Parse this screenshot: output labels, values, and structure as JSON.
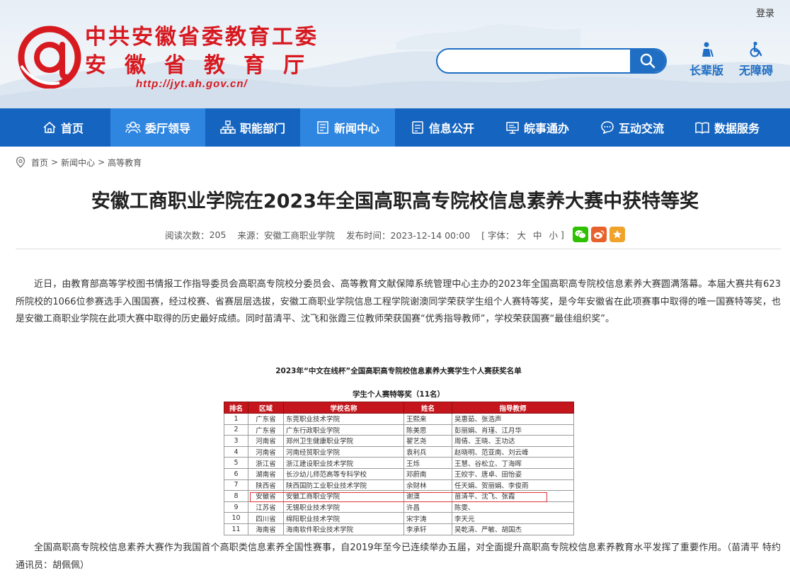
{
  "header": {
    "org_name": "中共安徽省委教育工委",
    "dept_name": "安徽省教育厅",
    "url": "http://jyt.ah.gov.cn/",
    "login": "登录",
    "search": {
      "placeholder": ""
    },
    "tools": [
      {
        "label": "长辈版",
        "icon": "elder-icon"
      },
      {
        "label": "无障碍",
        "icon": "accessibility-icon"
      }
    ]
  },
  "nav": {
    "items": [
      {
        "label": "首页",
        "icon": "home-icon"
      },
      {
        "label": "委厅领导",
        "icon": "leaders-icon"
      },
      {
        "label": "职能部门",
        "icon": "org-chart-icon"
      },
      {
        "label": "新闻中心",
        "icon": "news-icon"
      },
      {
        "label": "信息公开",
        "icon": "info-icon"
      },
      {
        "label": "皖事通办",
        "icon": "service-icon"
      },
      {
        "label": "互动交流",
        "icon": "chat-icon"
      },
      {
        "label": "数据服务",
        "icon": "data-icon"
      }
    ],
    "active_index": 3
  },
  "breadcrumb": {
    "items": [
      "首页",
      "新闻中心",
      "高等教育"
    ],
    "separator": ">"
  },
  "article": {
    "title": "安徽工商职业学院在2023年全国高职高专院校信息素养大赛中获特等奖",
    "meta": {
      "views_label": "阅读次数：",
      "views": "205",
      "source": "来源：安徽工商职业学院",
      "publish": "发布时间：2023-12-14 00:00",
      "font_open": "[ 字体：",
      "font_large": "大",
      "font_medium": "中",
      "font_small": "小",
      "font_close": "]"
    },
    "share": [
      {
        "icon": "wechat-icon",
        "color": "#2dc100"
      },
      {
        "icon": "weibo-icon",
        "color": "#e6612b"
      },
      {
        "icon": "favorite-icon",
        "color": "#f0a32a"
      }
    ],
    "paragraph1": "近日，由教育部高等学校图书情报工作指导委员会高职高专院校分委员会、高等教育文献保障系统管理中心主办的2023年全国高职高专院校信息素养大赛圆满落幕。本届大赛共有623所院校的1066位参赛选手入围国赛，经过校赛、省赛层层选拔，安徽工商职业学院信息工程学院谢澳同学荣获学生组个人赛特等奖，是今年安徽省在此项赛事中取得的唯一国赛特等奖，也是安徽工商职业学院在此项大赛中取得的历史最好成绩。同时苗清平、沈飞和张霞三位教师荣获国赛“优秀指导教师”，学校荣获国赛“最佳组织奖”。",
    "paragraph2": "全国高职高专院校信息素养大赛作为我国首个高职类信息素养全国性赛事，自2019年至今已连续举办五届，对全面提升高职高专院校信息素养教育水平发挥了重要作用。（苗清平 特约通讯员：胡佩佩）"
  },
  "awards_table": {
    "caption": "2023年“中文在线杯”全国高职高专院校信息素养大赛学生个人赛获奖名单",
    "subcaption": "学生个人赛特等奖（11名）",
    "headers": [
      "排名",
      "区域",
      "学校名称",
      "姓名",
      "指导教师"
    ],
    "rows": [
      [
        "1",
        "广东省",
        "东莞职业技术学院",
        "王熙来",
        "吴惠茹、张浩声"
      ],
      [
        "2",
        "广东省",
        "广东行政职业学院",
        "陈美思",
        "彭丽娟、肖瑾、江月华"
      ],
      [
        "3",
        "河南省",
        "郑州卫生健康职业学院",
        "翟艺尧",
        "周倩、王晓、王功达"
      ],
      [
        "4",
        "河南省",
        "河南经贸职业学院",
        "袁利兵",
        "赵晓明、范亚南、刘云峰"
      ],
      [
        "5",
        "浙江省",
        "浙江建设职业技术学院",
        "王烁",
        "王慧、谷松立、丁海晖"
      ],
      [
        "6",
        "湖南省",
        "长沙幼儿师范高等专科学校",
        "邓蔚南",
        "王姣宇、唐卓、田怡姿"
      ],
      [
        "7",
        "陕西省",
        "陕西国防工业职业技术学院",
        "余财林",
        "任天娟、贺丽娟、李俊雨"
      ],
      [
        "8",
        "安徽省",
        "安徽工商职业学院",
        "谢澳",
        "苗清平、沈飞、张霞"
      ],
      [
        "9",
        "江苏省",
        "无锡职业技术学院",
        "许昌",
        "陈雯、"
      ],
      [
        "10",
        "四川省",
        "绵阳职业技术学院",
        "宋宇涛",
        "李天元"
      ],
      [
        "11",
        "海南省",
        "海南软件职业技术学院",
        "李承轩",
        "吴乾清、严敏、胡国杰"
      ]
    ],
    "highlight_row": 8,
    "colors": {
      "header_bg": "#c4161c",
      "highlight": "#e0343a"
    }
  },
  "colors": {
    "brand_red": "#d71920",
    "nav_blue": "#1565c0",
    "nav_active": "#2f86e0"
  }
}
